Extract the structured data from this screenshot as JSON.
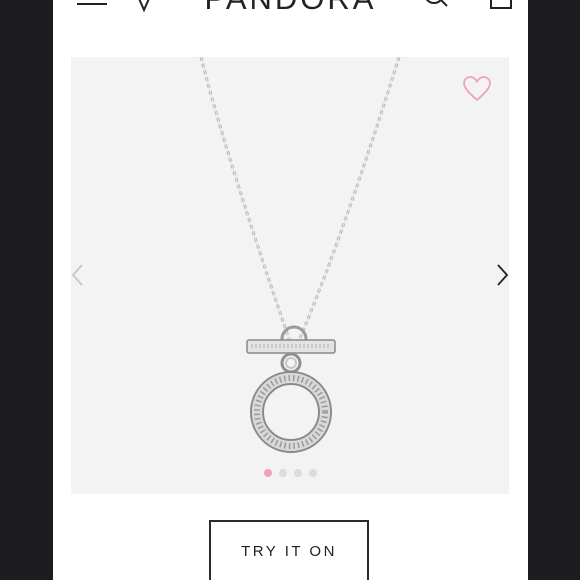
{
  "header": {
    "brand": "PANDORA",
    "icons": [
      "menu-icon",
      "location-pin-icon",
      "search-icon",
      "shopping-bag-icon"
    ]
  },
  "gallery": {
    "image": "silver-necklace-with-toggle-bar-and-pave-circle-pendant",
    "slide_count": 4,
    "active_slide": 1,
    "favorite_icon": "heart-outline-icon",
    "favorite_color": "#f1a3b5"
  },
  "actions": {
    "try_it_on_label": "TRY IT ON"
  }
}
